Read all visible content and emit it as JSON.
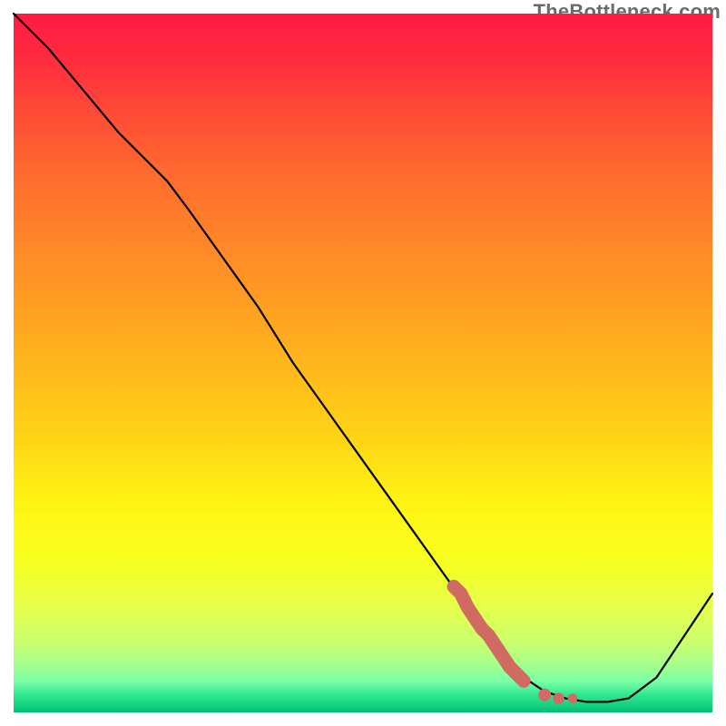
{
  "watermark": "TheBottleneck.com",
  "chart_data": {
    "type": "line",
    "title": "",
    "xlabel": "",
    "ylabel": "",
    "xlim": [
      0,
      100
    ],
    "ylim": [
      0,
      100
    ],
    "grid": false,
    "legend": false,
    "series": [
      {
        "name": "curve",
        "color": "#000000",
        "x": [
          0,
          5,
          10,
          15,
          20,
          22,
          25,
          30,
          35,
          40,
          45,
          50,
          55,
          60,
          65,
          68,
          70,
          73,
          76,
          79,
          82,
          85,
          88,
          92,
          96,
          100
        ],
        "y": [
          100,
          95,
          89,
          83,
          78,
          76,
          72,
          65,
          58,
          50,
          43,
          36,
          29,
          22,
          15,
          11,
          8,
          5,
          3,
          2,
          1.5,
          1.5,
          2,
          5,
          11,
          17
        ]
      }
    ],
    "highlight_segment": {
      "name": "highlight",
      "color": "#d16a62",
      "x": [
        63,
        64,
        65,
        66,
        67,
        68,
        69,
        70,
        71,
        72,
        73,
        76,
        78,
        80
      ],
      "y": [
        18,
        17,
        15,
        13.5,
        12,
        11,
        9.5,
        8,
        6.5,
        5.5,
        4.5,
        2.5,
        2,
        2
      ]
    },
    "background_gradient": {
      "stops": [
        {
          "offset": 0.0,
          "color": "#ff1a44"
        },
        {
          "offset": 0.06,
          "color": "#ff2a3e"
        },
        {
          "offset": 0.14,
          "color": "#ff4a36"
        },
        {
          "offset": 0.24,
          "color": "#ff6e2e"
        },
        {
          "offset": 0.36,
          "color": "#ff8f26"
        },
        {
          "offset": 0.48,
          "color": "#ffb01e"
        },
        {
          "offset": 0.6,
          "color": "#ffd216"
        },
        {
          "offset": 0.7,
          "color": "#fff312"
        },
        {
          "offset": 0.78,
          "color": "#f8ff20"
        },
        {
          "offset": 0.85,
          "color": "#e5ff4a"
        },
        {
          "offset": 0.9,
          "color": "#c8ff6e"
        },
        {
          "offset": 0.93,
          "color": "#a8ff8a"
        },
        {
          "offset": 0.955,
          "color": "#7dffa6"
        },
        {
          "offset": 0.975,
          "color": "#30e890"
        },
        {
          "offset": 1.0,
          "color": "#00c074"
        }
      ]
    }
  }
}
